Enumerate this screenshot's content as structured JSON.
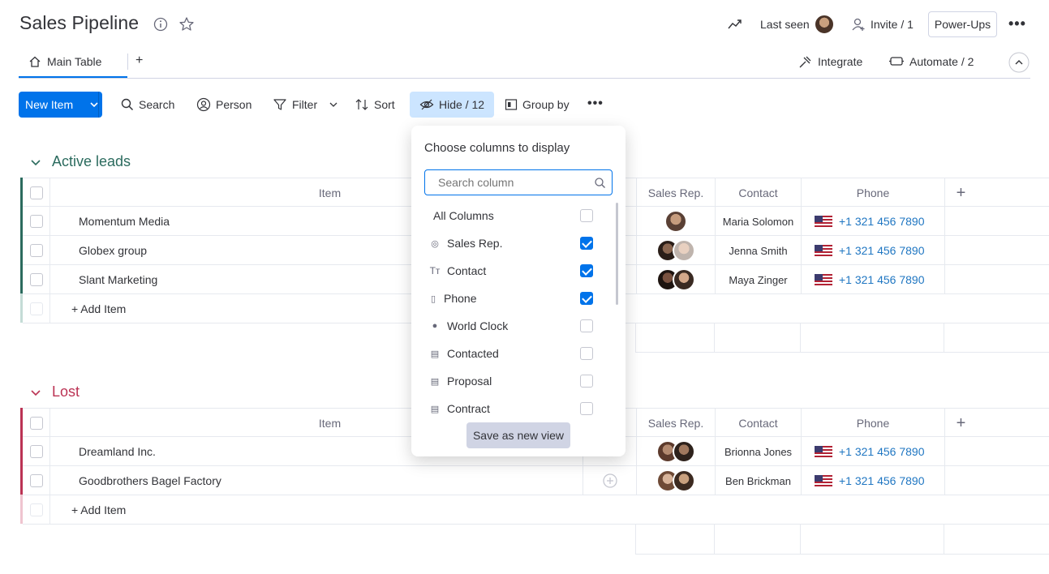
{
  "header": {
    "title": "Sales Pipeline",
    "last_seen_label": "Last seen",
    "invite_label": "Invite / 1",
    "powerups_label": "Power-Ups"
  },
  "tabs": {
    "main_table_label": "Main Table",
    "add_tab_label": "+",
    "integrate_label": "Integrate",
    "automate_label": "Automate / 2"
  },
  "toolbar": {
    "new_item_label": "New Item",
    "search_label": "Search",
    "person_label": "Person",
    "filter_label": "Filter",
    "sort_label": "Sort",
    "hide_label": "Hide / 12",
    "group_by_label": "Group by"
  },
  "columns": {
    "item": "Item",
    "sales_rep": "Sales Rep.",
    "contact": "Contact",
    "phone": "Phone"
  },
  "groups": [
    {
      "title": "Active leads",
      "color": "#2b6b5e",
      "rows": [
        {
          "item": "Momentum Media",
          "contact": "Maria Solomon",
          "phone": "+1 321 456 7890"
        },
        {
          "item": "Globex group",
          "contact": "Jenna Smith",
          "phone": "+1 321 456 7890"
        },
        {
          "item": "Slant Marketing",
          "contact": "Maya Zinger",
          "phone": "+1 321 456 7890"
        }
      ],
      "add_item_label": "+ Add Item"
    },
    {
      "title": "Lost",
      "color": "#bb3354",
      "rows": [
        {
          "item": "Dreamland Inc.",
          "contact": "Brionna Jones",
          "phone": "+1 321 456 7890"
        },
        {
          "item": "Goodbrothers Bagel Factory",
          "contact": "Ben Brickman",
          "phone": "+1 321 456 7890"
        }
      ],
      "add_item_label": "+ Add Item"
    }
  ],
  "popup": {
    "title": "Choose columns to display",
    "search_placeholder": "Search column",
    "options": [
      {
        "label": "All Columns",
        "checked": false
      },
      {
        "label": "Sales Rep.",
        "checked": true
      },
      {
        "label": "Contact",
        "checked": true
      },
      {
        "label": "Phone",
        "checked": true
      },
      {
        "label": "World Clock",
        "checked": false
      },
      {
        "label": "Contacted",
        "checked": false
      },
      {
        "label": "Proposal",
        "checked": false
      },
      {
        "label": "Contract",
        "checked": false
      }
    ],
    "save_view_label": "Save as new view"
  },
  "colors": {
    "primary": "#0073ea",
    "hide_active_bg": "#cce5ff",
    "active_group": "#2b6b5e",
    "lost_group": "#bb3354",
    "link": "#1f76c2"
  }
}
